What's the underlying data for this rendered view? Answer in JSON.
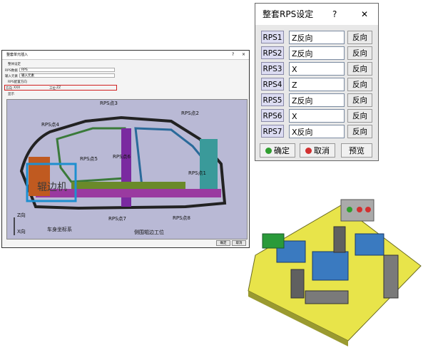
{
  "main_window": {
    "title": "整套单元插入",
    "help": "?",
    "close": "×",
    "section_basic": "整体设定",
    "rps_label": "RPS数据",
    "rps_value": "RPS",
    "input_label": "输入元素",
    "input_value": "输入元素",
    "config_section": "RPS配置方向",
    "dir_label": "方向",
    "dir_value": "XXX",
    "station_label": "工位",
    "station_value": "ZZ",
    "display_label": "显示",
    "ok": "确定",
    "cancel": "取消"
  },
  "canvas": {
    "callouts": [
      "RPS点3",
      "RPS点2",
      "RPS点4",
      "RPS点5",
      "RPS点6",
      "RPS点1",
      "RPS点7",
      "RPS点8"
    ],
    "overlay_text": "辊边机",
    "z_label": "Z向",
    "x_label": "X向",
    "coord_caption": "车身坐标系",
    "station_caption": "侧围辊边工位"
  },
  "rps_dialog": {
    "title": "整套RPS设定",
    "help": "?",
    "close": "✕",
    "rows": [
      {
        "btn": "RPS1",
        "value": "Z反向",
        "rev": "反向"
      },
      {
        "btn": "RPS2",
        "value": "Z反向",
        "rev": "反向"
      },
      {
        "btn": "RPS3",
        "value": "X",
        "rev": "反向"
      },
      {
        "btn": "RPS4",
        "value": "Z",
        "rev": "反向"
      },
      {
        "btn": "RPS5",
        "value": "Z反向",
        "rev": "反向"
      },
      {
        "btn": "RPS6",
        "value": "X",
        "rev": "反向"
      },
      {
        "btn": "RPS7",
        "value": "X反向",
        "rev": "反向"
      }
    ],
    "ok": "确定",
    "cancel": "取消",
    "preview": "预览",
    "ok_color": "#2f9e2f",
    "cancel_color": "#d23030"
  }
}
